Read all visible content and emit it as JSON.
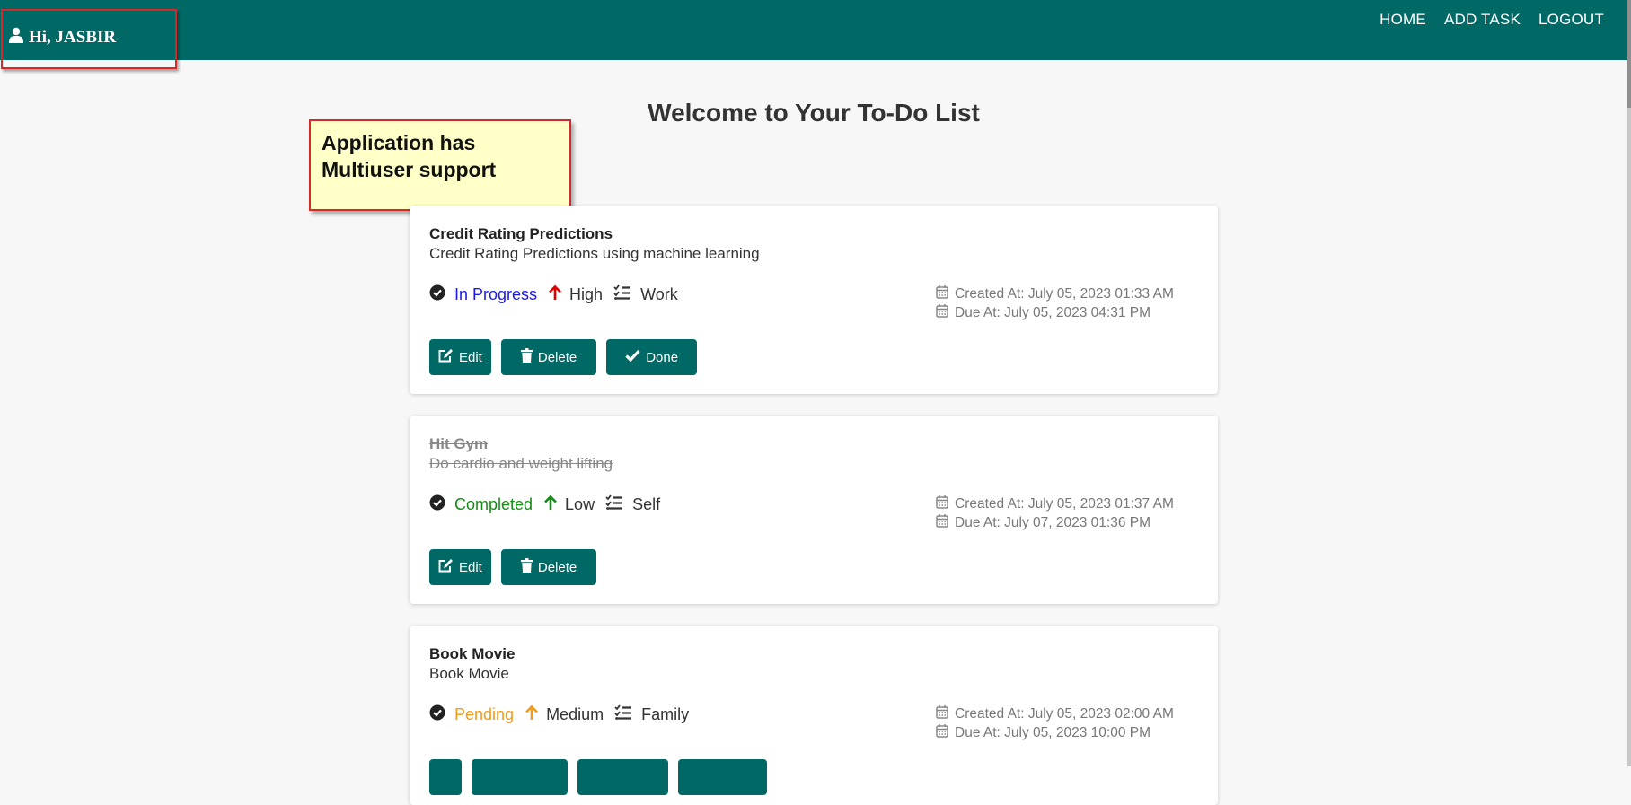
{
  "header": {
    "greeting": "Hi, JASBIR",
    "nav": [
      {
        "label": "HOME"
      },
      {
        "label": "ADD TASK"
      },
      {
        "label": "LOGOUT"
      }
    ]
  },
  "page": {
    "title": "Welcome to Your To-Do List"
  },
  "annotation": {
    "line1": "Application has",
    "line2": "Multiuser support"
  },
  "tasks": [
    {
      "title": "Credit Rating Predictions",
      "description": "Credit Rating Predictions using machine learning",
      "status": "In Progress",
      "priority": "High",
      "category": "Work",
      "created": "Created At: July 05, 2023 01:33 AM",
      "due": "Due At: July 05, 2023 04:31 PM",
      "buttons": {
        "edit": "Edit",
        "delete": "Delete",
        "done": "Done"
      }
    },
    {
      "title": "Hit Gym",
      "description": "Do cardio and weight lifting",
      "status": "Completed",
      "priority": "Low",
      "category": "Self",
      "created": "Created At: July 05, 2023 01:37 AM",
      "due": "Due At: July 07, 2023 01:36 PM",
      "buttons": {
        "edit": "Edit",
        "delete": "Delete"
      }
    },
    {
      "title": "Book Movie",
      "description": "Book Movie",
      "status": "Pending",
      "priority": "Medium",
      "category": "Family",
      "created": "Created At: July 05, 2023 02:00 AM",
      "due": "Due At: July 05, 2023 10:00 PM"
    }
  ],
  "colors": {
    "brand": "#006865",
    "in_progress": "#1a1ae6",
    "completed": "#168a16",
    "pending": "#f29a1c",
    "priority_high": "#e00000",
    "priority_low": "#168a16",
    "priority_medium": "#f29a1c"
  },
  "icons": [
    "user-icon",
    "check-circle-icon",
    "arrow-up-icon",
    "list-check-icon",
    "calendar-icon",
    "edit-icon",
    "trash-icon",
    "check-icon"
  ]
}
